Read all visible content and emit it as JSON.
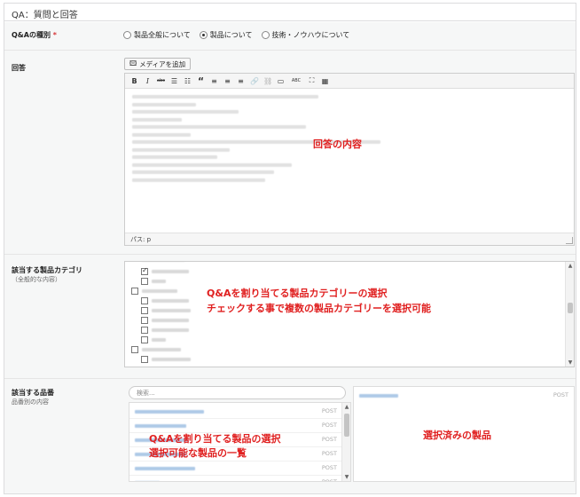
{
  "panel_title": "QA：質問と回答",
  "qa_type": {
    "label": "Q&Aの種別",
    "required_mark": "*",
    "options": [
      "製品全般について",
      "製品について",
      "技術・ノウハウについて"
    ],
    "selected_index": 1
  },
  "answer": {
    "label": "回答",
    "media_button": "メディアを追加",
    "toolbar_icons": [
      "bold",
      "italic",
      "strikethrough",
      "bullet-list",
      "numbered-list",
      "blockquote",
      "align-left",
      "align-center",
      "align-right",
      "link",
      "unlink",
      "more",
      "spellcheck",
      "fullscreen",
      "kitchen-sink"
    ],
    "toolbar_glyphs": [
      "B",
      "I",
      "abc",
      "☰",
      "☷",
      "“",
      "≡",
      "≡",
      "≡",
      "🔗",
      "⛓",
      "▭",
      "ABC",
      "⛶",
      "▦"
    ],
    "status_path": "パス: p",
    "annotation": "回答の内容"
  },
  "category": {
    "label": "該当する製品カテゴリ",
    "sublabel": "（全般的な内容）",
    "annotation_line1": "Q&Aを割り当てる製品カテゴリーの選択",
    "annotation_line2": "チェックする事で複数の製品カテゴリーを選択可能"
  },
  "products": {
    "label": "該当する品番",
    "sublabel": "品番別の内容",
    "search_placeholder": "検索...",
    "post_tag": "POST",
    "annotation_line1": "Q&Aを割り当てる製品の選択",
    "annotation_line2": "選択可能な製品の一覧",
    "selected_annotation": "選択済みの製品"
  }
}
